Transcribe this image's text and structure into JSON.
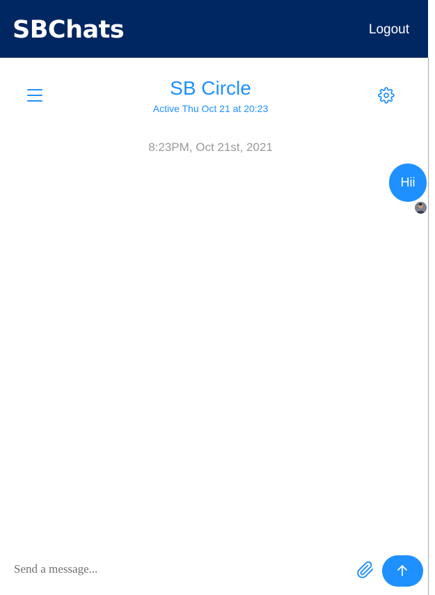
{
  "app": {
    "brand": "SBChats",
    "logout_label": "Logout"
  },
  "chat": {
    "title": "SB Circle",
    "status": "Active Thu Oct 21 at 20:23"
  },
  "messages": {
    "timestamp": "8:23PM, Oct 21st, 2021",
    "items": [
      {
        "text": "Hii",
        "sender": "self"
      }
    ]
  },
  "composer": {
    "placeholder": "Send a message...",
    "value": ""
  },
  "icons": {
    "menu": "hamburger-menu-icon",
    "settings": "gear-icon",
    "attach": "paperclip-icon",
    "send": "arrow-up-icon"
  },
  "colors": {
    "navbar": "#002762",
    "accent": "#1e90ff",
    "timestamp": "#9a9a9a"
  }
}
